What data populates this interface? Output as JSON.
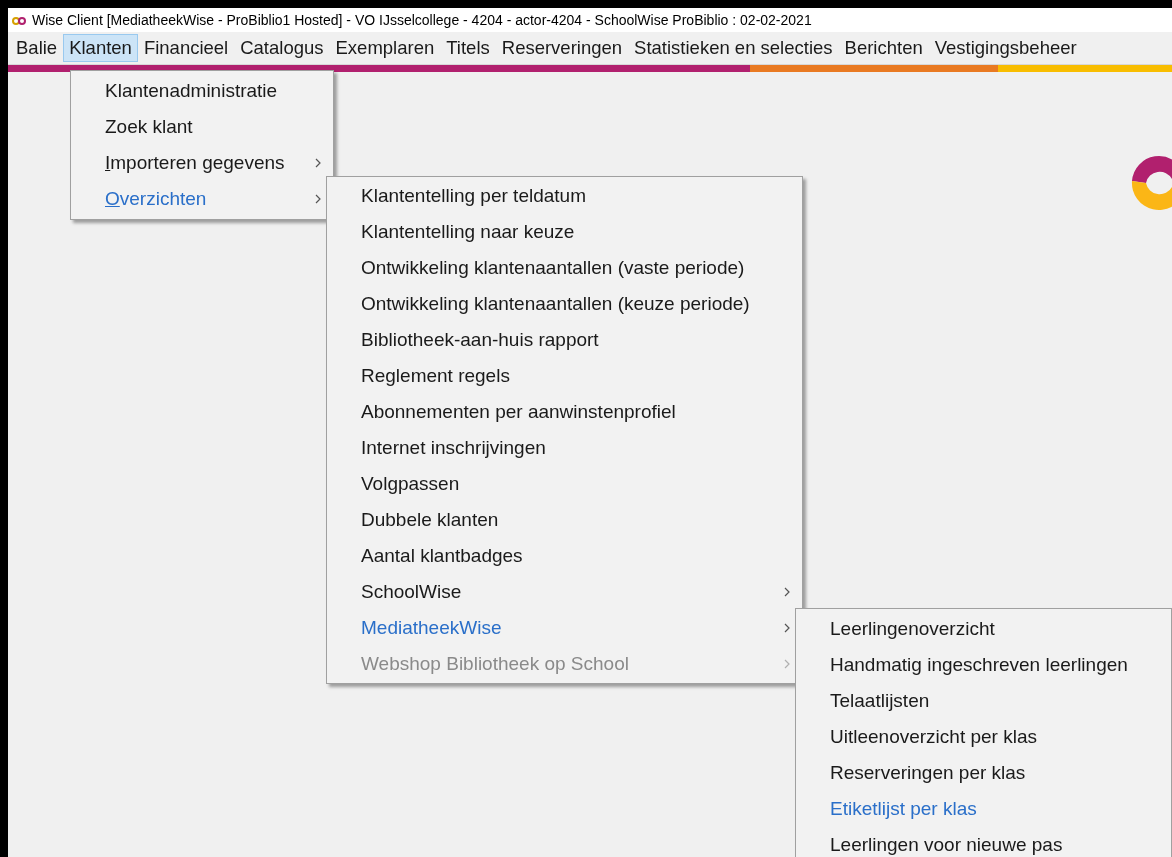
{
  "window": {
    "title": "Wise Client [MediatheekWise - ProBiblio1 Hosted] - VO IJsselcollege - 4204 - actor-4204 - SchoolWise ProBiblio : 02-02-2021"
  },
  "menubar": [
    {
      "label": "Balie",
      "selected": false
    },
    {
      "label": "Klanten",
      "selected": true
    },
    {
      "label": "Financieel",
      "selected": false
    },
    {
      "label": "Catalogus",
      "selected": false
    },
    {
      "label": "Exemplaren",
      "selected": false
    },
    {
      "label": "Titels",
      "selected": false
    },
    {
      "label": "Reserveringen",
      "selected": false
    },
    {
      "label": "Statistieken en selecties",
      "selected": false
    },
    {
      "label": "Berichten",
      "selected": false
    },
    {
      "label": "Vestigingsbeheer",
      "selected": false
    }
  ],
  "menus": [
    {
      "items": [
        {
          "label": "Klantenadministratie",
          "selected": false,
          "disabled": false,
          "submenu": false,
          "mnemonic": false
        },
        {
          "label": "Zoek klant",
          "selected": false,
          "disabled": false,
          "submenu": false,
          "mnemonic": false
        },
        {
          "label": "Importeren gegevens",
          "selected": false,
          "disabled": false,
          "submenu": true,
          "mnemonic": true
        },
        {
          "label": "Overzichten",
          "selected": true,
          "disabled": false,
          "submenu": true,
          "mnemonic": true
        }
      ]
    },
    {
      "items": [
        {
          "label": "Klantentelling per teldatum",
          "selected": false,
          "disabled": false,
          "submenu": false,
          "mnemonic": false
        },
        {
          "label": "Klantentelling naar keuze",
          "selected": false,
          "disabled": false,
          "submenu": false,
          "mnemonic": false
        },
        {
          "label": "Ontwikkeling klantenaantallen (vaste periode)",
          "selected": false,
          "disabled": false,
          "submenu": false,
          "mnemonic": false
        },
        {
          "label": "Ontwikkeling klantenaantallen (keuze periode)",
          "selected": false,
          "disabled": false,
          "submenu": false,
          "mnemonic": false
        },
        {
          "label": "Bibliotheek-aan-huis rapport",
          "selected": false,
          "disabled": false,
          "submenu": false,
          "mnemonic": false
        },
        {
          "label": "Reglement regels",
          "selected": false,
          "disabled": false,
          "submenu": false,
          "mnemonic": false
        },
        {
          "label": "Abonnementen per aanwinstenprofiel",
          "selected": false,
          "disabled": false,
          "submenu": false,
          "mnemonic": false
        },
        {
          "label": "Internet inschrijvingen",
          "selected": false,
          "disabled": false,
          "submenu": false,
          "mnemonic": false
        },
        {
          "label": "Volgpassen",
          "selected": false,
          "disabled": false,
          "submenu": false,
          "mnemonic": false
        },
        {
          "label": "Dubbele klanten",
          "selected": false,
          "disabled": false,
          "submenu": false,
          "mnemonic": false
        },
        {
          "label": "Aantal klantbadges",
          "selected": false,
          "disabled": false,
          "submenu": false,
          "mnemonic": false
        },
        {
          "label": "SchoolWise",
          "selected": false,
          "disabled": false,
          "submenu": true,
          "mnemonic": false
        },
        {
          "label": "MediatheekWise",
          "selected": true,
          "disabled": false,
          "submenu": true,
          "mnemonic": false
        },
        {
          "label": "Webshop Bibliotheek op School",
          "selected": false,
          "disabled": true,
          "submenu": true,
          "mnemonic": false
        }
      ]
    },
    {
      "items": [
        {
          "label": "Leerlingenoverzicht",
          "selected": false,
          "disabled": false,
          "submenu": false,
          "mnemonic": false
        },
        {
          "label": "Handmatig ingeschreven leerlingen",
          "selected": false,
          "disabled": false,
          "submenu": false,
          "mnemonic": false
        },
        {
          "label": "Telaatlijsten",
          "selected": false,
          "disabled": false,
          "submenu": false,
          "mnemonic": false
        },
        {
          "label": "Uitleenoverzicht per klas",
          "selected": false,
          "disabled": false,
          "submenu": false,
          "mnemonic": false
        },
        {
          "label": "Reserveringen per klas",
          "selected": false,
          "disabled": false,
          "submenu": false,
          "mnemonic": false
        },
        {
          "label": "Etiketlijst per klas",
          "selected": true,
          "disabled": false,
          "submenu": false,
          "mnemonic": false
        },
        {
          "label": "Leerlingen voor nieuwe pas",
          "selected": false,
          "disabled": false,
          "submenu": false,
          "mnemonic": false
        }
      ]
    }
  ]
}
